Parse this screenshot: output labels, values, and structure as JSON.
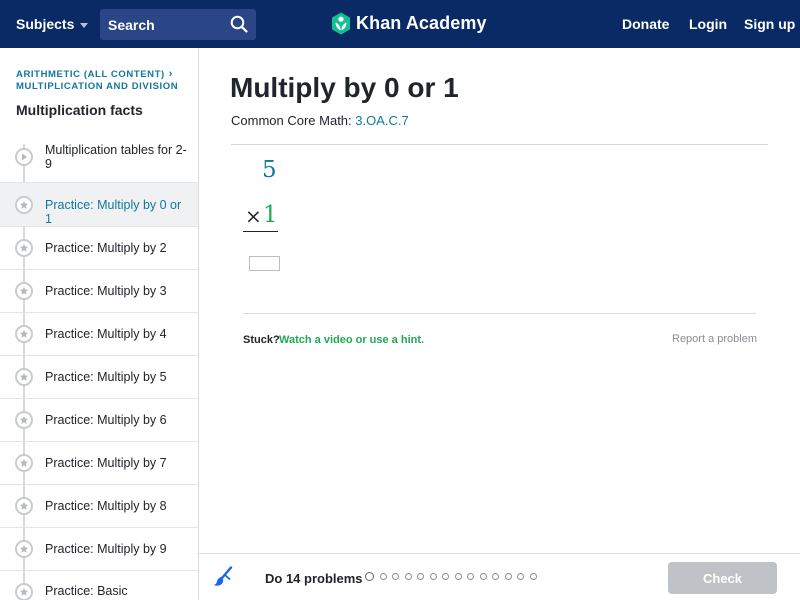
{
  "colors": {
    "nav_bg": "#0a2a66",
    "link_blue": "#11779f",
    "green": "#1fab54",
    "check_disabled": "#bfc2c6"
  },
  "nav": {
    "subjects_label": "Subjects",
    "search_placeholder": "Search",
    "logo_text": "Khan Academy",
    "donate_label": "Donate",
    "login_label": "Login",
    "signup_label": "Sign up",
    "icons": {
      "subjects": "chevron-down-icon",
      "search": "search-icon",
      "logo": "khan-leaf-logo"
    }
  },
  "sidebar": {
    "breadcrumb_1": "ARITHMETIC (ALL CONTENT)",
    "breadcrumb_2": "MULTIPLICATION AND DIVISION",
    "title": "Multiplication facts",
    "items": [
      {
        "label": "Multiplication tables for 2-9",
        "icon": "play-icon",
        "active": false
      },
      {
        "label": "Practice: Multiply by 0 or 1",
        "icon": "star-icon",
        "active": true
      },
      {
        "label": "Practice: Multiply by 2",
        "icon": "star-icon",
        "active": false
      },
      {
        "label": "Practice: Multiply by 3",
        "icon": "star-icon",
        "active": false
      },
      {
        "label": "Practice: Multiply by 4",
        "icon": "star-icon",
        "active": false
      },
      {
        "label": "Practice: Multiply by 5",
        "icon": "star-icon",
        "active": false
      },
      {
        "label": "Practice: Multiply by 6",
        "icon": "star-icon",
        "active": false
      },
      {
        "label": "Practice: Multiply by 7",
        "icon": "star-icon",
        "active": false
      },
      {
        "label": "Practice: Multiply by 8",
        "icon": "star-icon",
        "active": false
      },
      {
        "label": "Practice: Multiply by 9",
        "icon": "star-icon",
        "active": false
      },
      {
        "label": "Practice: Basic",
        "icon": "star-icon",
        "active": false
      }
    ]
  },
  "main": {
    "title": "Multiply by 0 or 1",
    "standard_prefix": "Common Core Math:",
    "standard_code": "3.OA.C.7",
    "problem": {
      "top_number": "5",
      "operator": "×",
      "bottom_number": "1",
      "answer_value": ""
    },
    "stuck_label": "Stuck?",
    "hint_link": "Watch a video or use a hint.",
    "report_link": "Report a problem"
  },
  "footer": {
    "task_label": "Do 14 problems",
    "problem_count": 14,
    "check_label": "Check",
    "icon": "brush-icon"
  }
}
